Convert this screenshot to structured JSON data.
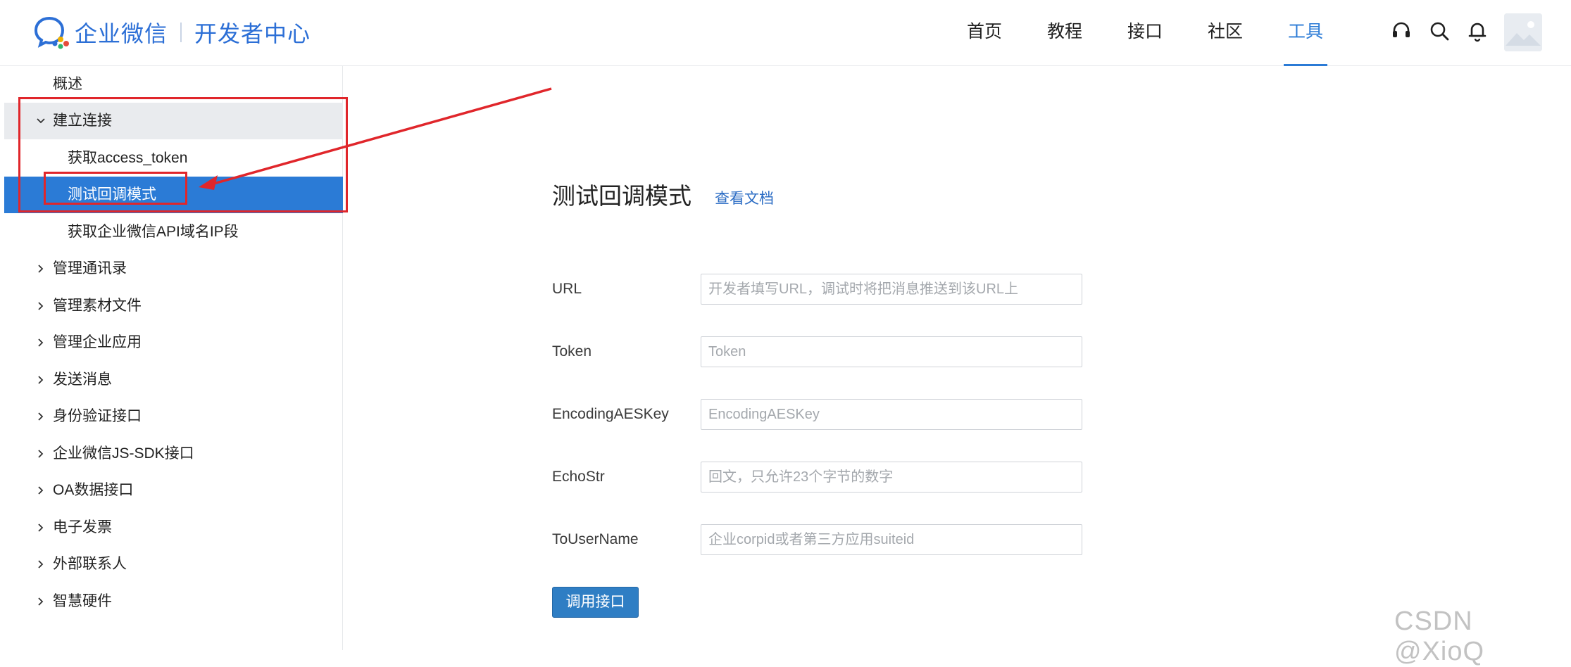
{
  "header": {
    "brand_name": "企业微信",
    "brand_sub": "开发者中心",
    "nav": [
      {
        "label": "首页"
      },
      {
        "label": "教程"
      },
      {
        "label": "接口"
      },
      {
        "label": "社区"
      },
      {
        "label": "工具",
        "active": true
      }
    ],
    "icons": [
      "headset-icon",
      "search-icon",
      "bell-icon",
      "avatar"
    ]
  },
  "sidebar": {
    "items": [
      {
        "label": "概述"
      },
      {
        "label": "建立连接",
        "expanded": true
      },
      {
        "label": "获取access_token"
      },
      {
        "label": "测试回调模式",
        "selected": true
      },
      {
        "label": "获取企业微信API域名IP段"
      },
      {
        "label": "管理通讯录"
      },
      {
        "label": "管理素材文件"
      },
      {
        "label": "管理企业应用"
      },
      {
        "label": "发送消息"
      },
      {
        "label": "身份验证接口"
      },
      {
        "label": "企业微信JS-SDK接口"
      },
      {
        "label": "OA数据接口"
      },
      {
        "label": "电子发票"
      },
      {
        "label": "外部联系人"
      },
      {
        "label": "智慧硬件"
      }
    ]
  },
  "main": {
    "title": "测试回调模式",
    "doc_link": "查看文档",
    "fields": [
      {
        "label": "URL",
        "placeholder": "开发者填写URL，调试时将把消息推送到该URL上",
        "value": ""
      },
      {
        "label": "Token",
        "placeholder": "Token",
        "value": ""
      },
      {
        "label": "EncodingAESKey",
        "placeholder": "EncodingAESKey",
        "value": ""
      },
      {
        "label": "EchoStr",
        "placeholder": "回文，只允许23个字节的数字",
        "value": ""
      },
      {
        "label": "ToUserName",
        "placeholder": "企业corpid或者第三方应用suiteid",
        "value": ""
      }
    ],
    "submit_label": "调用接口"
  },
  "watermark": "CSDN @XioQ",
  "colors": {
    "accent": "#2b7bd6",
    "brand": "#2c6fd6",
    "annotation_red": "#e0262b",
    "button": "#2f7ec4"
  }
}
